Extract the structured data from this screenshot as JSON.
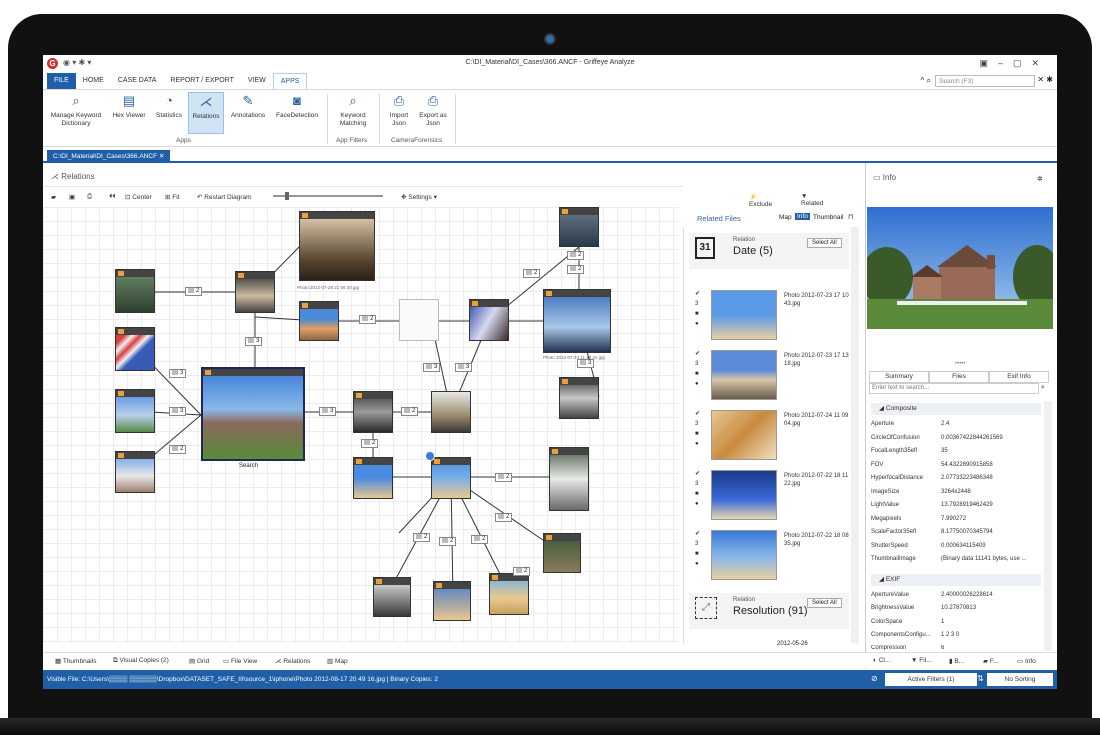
{
  "window": {
    "title": "C:\\DI_Material\\DI_Cases\\366.ANCF - Griffeye Analyze"
  },
  "menu": {
    "items": [
      "FILE",
      "HOME",
      "CASE DATA",
      "REPORT / EXPORT",
      "VIEW",
      "APPS"
    ],
    "search_placeholder": "Search (F3)"
  },
  "ribbon": {
    "buttons": [
      "Manage Keyword Dictionary",
      "Hex Viewer",
      "Statistics",
      "Relations",
      "Annotations",
      "FaceDetection",
      "Keyword Matching",
      "Import Json",
      "Export as Json"
    ],
    "groups": [
      "Apps",
      "App Filters",
      "CameraForensics"
    ]
  },
  "doc_tab": "C:\\DI_Material\\DI_Cases\\366.ANCF",
  "relations": {
    "title": "Relations",
    "toolbar": {
      "center": "Center",
      "fit": "Fit",
      "restart": "Restart Diagram",
      "settings": "Settings",
      "exclude": "Exclude",
      "related_files": "Related Files"
    },
    "nodes": {
      "main_label": "Search",
      "photo1_label": "Photo 2012-07-28 21 06 30.jpg",
      "photo2_label": "Photo 2012-07-23 11 19 22.jpg"
    },
    "badges": [
      "2",
      "3",
      "2",
      "3",
      "3",
      "2",
      "3",
      "2",
      "3",
      "3",
      "2",
      "2",
      "2",
      "3",
      "2",
      "2",
      "2",
      "2",
      "2",
      "2",
      "2"
    ]
  },
  "bottom_tabs": [
    "Thumbnails",
    "Visual Copies (2)",
    "Grid",
    "File View",
    "Relations",
    "Map"
  ],
  "related_files": {
    "title": "Related Files",
    "tabs": [
      "Map",
      "Info",
      "Thumbnail"
    ],
    "group1": {
      "heading": "Relation",
      "name": "Date (5)",
      "select_all": "Select All"
    },
    "files": [
      {
        "name": "Photo 2012-07-23 17 10 43.jpg",
        "count": "3"
      },
      {
        "name": "Photo 2012-07-23 17 13 18.jpg",
        "count": "3"
      },
      {
        "name": "Photo 2012-07-24 11 09 04.jpg",
        "count": "3"
      },
      {
        "name": "Photo 2012-07-22 18 11 22.jpg",
        "count": "3"
      },
      {
        "name": "Photo 2012-07-22 18 08 35.jpg",
        "count": "3"
      }
    ],
    "group2": {
      "heading": "Relation",
      "name": "Resolution (91)",
      "select_all": "Select All"
    },
    "next_file": "2012-05-26"
  },
  "info": {
    "title": "Info",
    "tabs": [
      "Summary",
      "Files",
      "Exif Info"
    ],
    "search_placeholder": "Enter text to search...",
    "composite_title": "Composite",
    "composite": [
      [
        "Aperture",
        "2.4"
      ],
      [
        "CircleOfConfusion",
        "0.00367422844261569"
      ],
      [
        "FocalLength35efl",
        "35"
      ],
      [
        "FOV",
        "54.4322690915858"
      ],
      [
        "HyperfocalDistance",
        "2.07733223486348"
      ],
      [
        "ImageSize",
        "3264x2448"
      ],
      [
        "LightValue",
        "13.7928919462429"
      ],
      [
        "Megapixels",
        "7.990272"
      ],
      [
        "ScaleFactor35efl",
        "8.17750070345794"
      ],
      [
        "ShutterSpeed",
        "0.000634115409"
      ],
      [
        "ThumbnailImage",
        "(Binary data 11141 bytes, use ..."
      ]
    ],
    "exif_title": "EXIF",
    "exif": [
      [
        "ApertureValue",
        "2.40000026228614"
      ],
      [
        "BrightnessValue",
        "10.27870813"
      ],
      [
        "ColorSpace",
        "1"
      ],
      [
        "ComponentsConfigu...",
        "1 2 3 0"
      ],
      [
        "Compression",
        "6"
      ]
    ],
    "bottom_tabs": [
      "Cl...",
      "Fil...",
      "B...",
      "F...",
      "Info"
    ]
  },
  "status": {
    "text": "Visible File: C:\\Users\\▒▒▒▒ ▒▒▒▒▒▒\\Dropbox\\DATASET_SAFE_III\\source_1\\iphone\\Photo 2012-08-17 20 49 16.jpg  |  Binary Copies: 2",
    "filters": "Active Filters (1)",
    "sorting": "No Sorting"
  },
  "colors": {
    "accent": "#1e5fa8",
    "ribbon_sel": "#cfe3f5"
  }
}
